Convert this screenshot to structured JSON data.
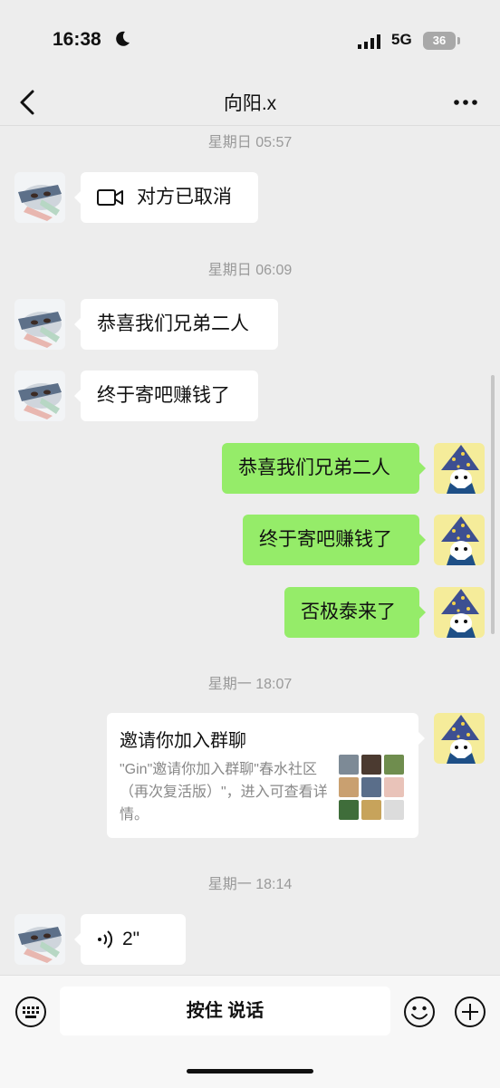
{
  "status": {
    "time": "16:38",
    "network": "5G",
    "battery": "36"
  },
  "header": {
    "title": "向阳.x"
  },
  "messages": {
    "ts1": "星期日 05:57",
    "call": "对方已取消",
    "ts2": "星期日 06:09",
    "m1": "恭喜我们兄弟二人",
    "m2": "终于寄吧赚钱了",
    "m3": "恭喜我们兄弟二人",
    "m4": "终于寄吧赚钱了",
    "m5": "否极泰来了",
    "ts3": "星期一 18:07",
    "invite_title": "邀请你加入群聊",
    "invite_desc": "\"Gin\"邀请你加入群聊\"春水社区（再次复活版）\"，进入可查看详情。",
    "ts4": "星期一 18:14",
    "voice_length": "2\""
  },
  "input": {
    "talk_label": "按住 说话"
  },
  "icons": {
    "back": "chevron-left-icon",
    "more": "more-dots-icon",
    "video": "video-call-icon",
    "voice": "voice-wave-icon",
    "keyboard": "keyboard-icon",
    "emoji": "emoji-icon",
    "plus": "plus-icon"
  },
  "colors": {
    "bubble_sent": "#95ec69",
    "bubble_received": "#ffffff",
    "background": "#ededed"
  }
}
